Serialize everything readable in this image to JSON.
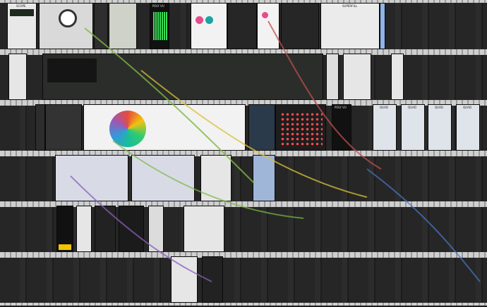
{
  "modules": [
    {
      "id": "scope-1",
      "label": "SCOPE",
      "theme": "light"
    },
    {
      "id": "knob-panel-1",
      "label": "",
      "theme": "light"
    },
    {
      "id": "dark-strip-1",
      "label": "",
      "theme": "dark"
    },
    {
      "id": "jack-panel-1",
      "label": "",
      "theme": "light"
    },
    {
      "id": "vu-meter-1",
      "label": "POLY VU",
      "theme": "dark"
    },
    {
      "id": "osc-pink",
      "label": "",
      "theme": "light"
    },
    {
      "id": "dark-sequencer-1",
      "label": "",
      "theme": "dark"
    },
    {
      "id": "osc-pink-2",
      "label": "",
      "theme": "light"
    },
    {
      "id": "dark-sequencer-2",
      "label": "",
      "theme": "dark"
    },
    {
      "id": "superfilter",
      "label": "SUPERFILL",
      "theme": "light"
    },
    {
      "id": "spectrum-mixer",
      "label": "",
      "theme": "dark"
    },
    {
      "id": "clock-panel",
      "label": "",
      "theme": "light"
    },
    {
      "id": "circle-fifths",
      "label": "",
      "theme": "light"
    },
    {
      "id": "poly-vu-2",
      "label": "POLY VU",
      "theme": "dark"
    },
    {
      "id": "matrix-led",
      "label": "",
      "theme": "dark"
    },
    {
      "id": "fader-1",
      "label": "QUAD",
      "theme": "light"
    },
    {
      "id": "fader-2",
      "label": "QUAD",
      "theme": "light"
    },
    {
      "id": "fader-3",
      "label": "QUAD",
      "theme": "light"
    },
    {
      "id": "fader-4",
      "label": "QUAD",
      "theme": "light"
    },
    {
      "id": "yellow-panel",
      "label": "",
      "theme": "dark"
    },
    {
      "id": "knobs-dark",
      "label": "",
      "theme": "dark"
    },
    {
      "id": "ladder",
      "label": "",
      "theme": "light"
    },
    {
      "id": "bottom-pair",
      "label": "",
      "theme": "light"
    }
  ],
  "colors": {
    "rack": "#1b1b1b",
    "rail": "#cfcfcf",
    "cable_green": "#7fb843",
    "cable_yellow": "#d8c23a",
    "cable_red": "#c0504d",
    "cable_blue": "#4a78c4",
    "cable_purple": "#8a62b8",
    "led_green": "#3ddc5a",
    "led_red": "#ff3e3e"
  }
}
